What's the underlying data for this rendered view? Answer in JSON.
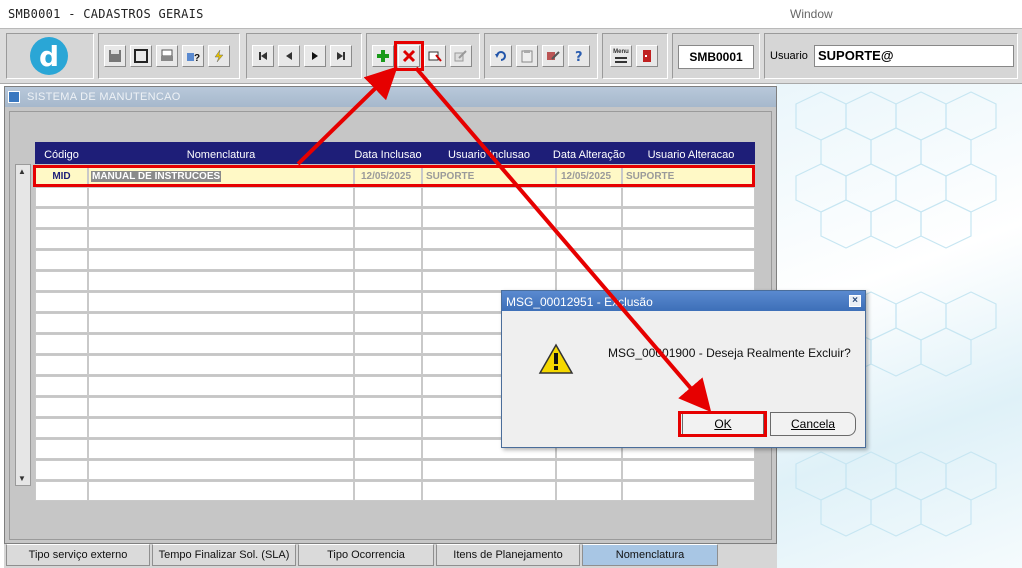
{
  "window": {
    "title": "SMB0001 - CADASTROS GERAIS",
    "menu_window": "Window"
  },
  "toolbar": {
    "logo_letter": "d",
    "form_code": "SMB0001",
    "user_label": "Usuario",
    "user_value": "SUPORTE@",
    "menu_icon_text": "Menu"
  },
  "main": {
    "title": "SISTEMA DE MANUTENCAO",
    "columns": [
      "Código",
      "Nomenclatura",
      "Data Inclusao",
      "Usuario Inclusao",
      "Data Alteração",
      "Usuario Alteracao"
    ],
    "selected_row": {
      "codigo": "MID",
      "nomenclatura": "MANUAL DE INSTRUCOES",
      "data_inclusao": "12/05/2025",
      "usuario_inclusao": "SUPORTE",
      "data_alteracao": "12/05/2025",
      "usuario_alteracao": "SUPORTE"
    }
  },
  "tabs": [
    "Tipo serviço externo",
    "Tempo Finalizar Sol. (SLA)",
    "Tipo Ocorrencia",
    "Itens de Planejamento",
    "Nomenclatura"
  ],
  "dialog": {
    "title": "MSG_00012951 - Exclusão",
    "close": "×",
    "message": "MSG_00001900 - Deseja Realmente Excluir?",
    "ok_label": "OK",
    "cancel_label": "Cancela"
  },
  "colors": {
    "annotation": "#e60000",
    "grid_header": "#1e1e78",
    "selected_row": "#fff9c6"
  }
}
